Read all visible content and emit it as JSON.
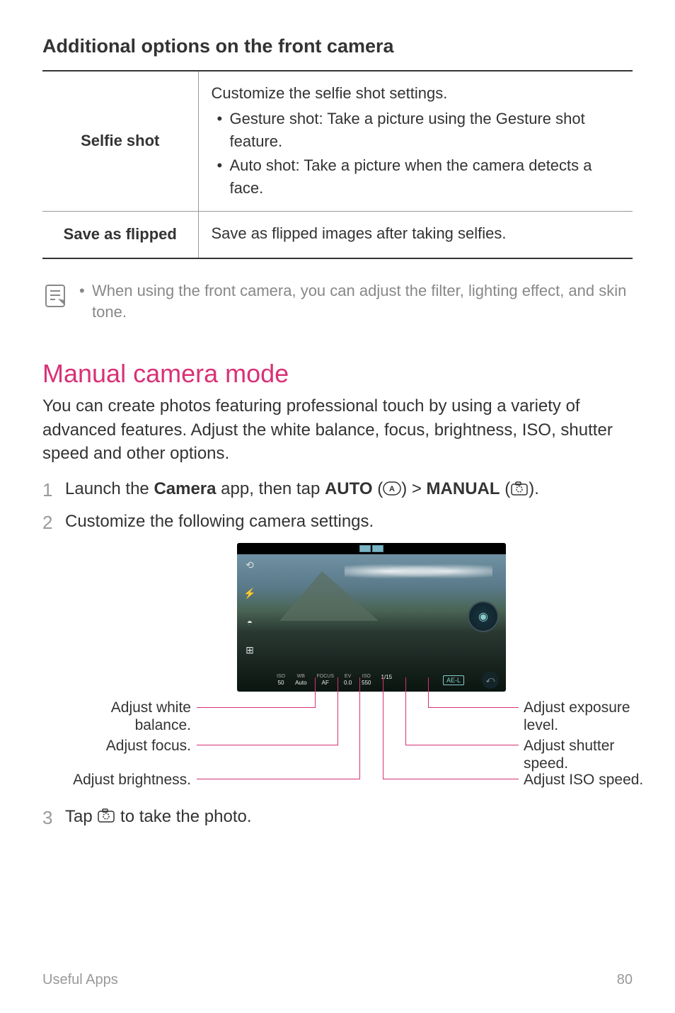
{
  "section_heading": "Additional options on the front camera",
  "table": {
    "rows": [
      {
        "label": "Selfie shot",
        "desc": "Customize the selfie shot settings.",
        "pre": "",
        "bullets": [
          "Gesture shot: Take a picture using the Gesture shot feature.",
          "Auto shot: Take a picture when the camera detects a face."
        ]
      },
      {
        "label": "Save as flipped",
        "desc": "Save as flipped images after taking selfies.",
        "bullets": []
      }
    ]
  },
  "note": "When using the front camera, you can adjust the filter, lighting effect, and skin tone.",
  "title": "Manual camera mode",
  "intro": "You can create photos featuring professional touch by using a variety of advanced features. Adjust the white balance, focus, brightness, ISO, shutter speed and other options.",
  "steps": {
    "s1_a": "Launch the ",
    "s1_b": "Camera",
    "s1_c": " app, then tap ",
    "s1_d": "AUTO",
    "s1_e": " (",
    "s1_f": ") > ",
    "s1_g": "MANUAL",
    "s1_h": " (",
    "s1_i": ").",
    "s2": "Customize the following camera settings.",
    "s3_a": "Tap ",
    "s3_b": " to take the photo."
  },
  "callouts": {
    "white_balance": "Adjust white balance.",
    "focus": "Adjust focus.",
    "brightness": "Adjust brightness.",
    "exposure": "Adjust exposure level.",
    "shutter": "Adjust shutter speed.",
    "iso": "Adjust ISO speed."
  },
  "camera_settings": {
    "iso_label": "ISO",
    "iso_value": "50",
    "wb_label": "WB",
    "wb_value": "Auto",
    "focus_label": "FOCUS",
    "focus_value": "AF",
    "ev_label": "EV",
    "ev_value": "0.0",
    "iso_speed_label": "ISO",
    "iso_speed_value": "550",
    "shutter_label": "",
    "shutter_value": "1/15",
    "ae_lock": "AE-L"
  },
  "footer": {
    "section": "Useful Apps",
    "page": "80"
  }
}
